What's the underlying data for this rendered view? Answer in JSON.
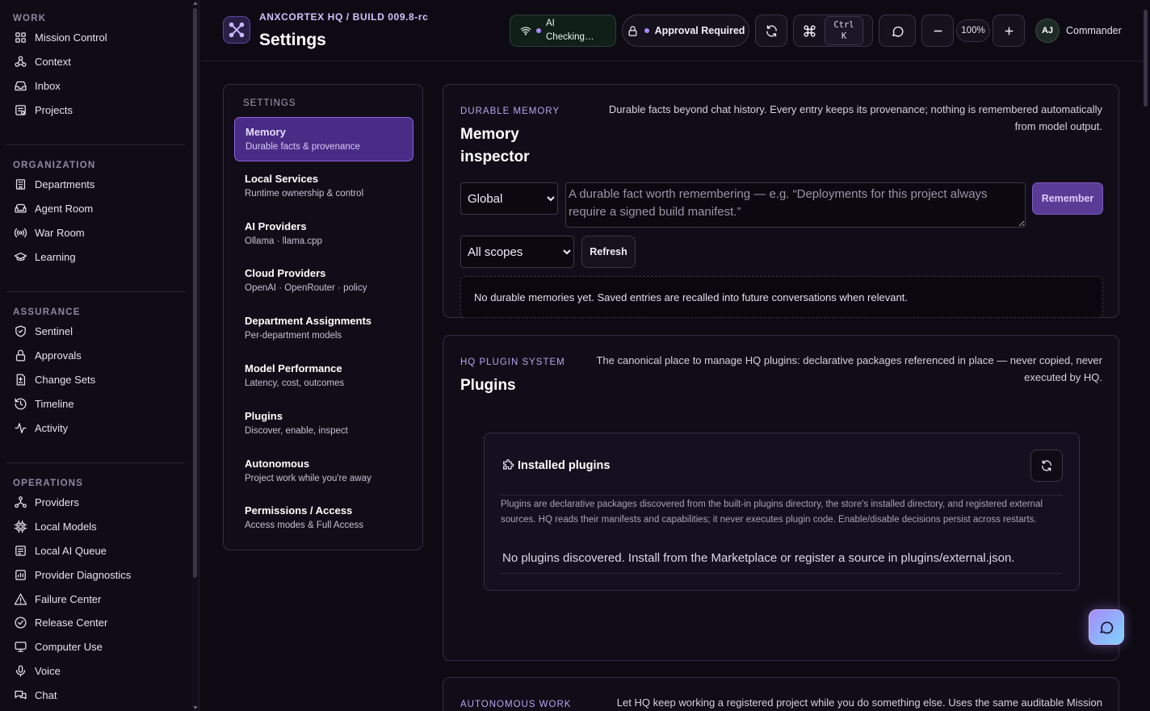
{
  "nav": {
    "sections": [
      {
        "heading": "WORK",
        "items": [
          {
            "label": "Mission Control",
            "icon": "grid-icon"
          },
          {
            "label": "Context",
            "icon": "network-icon"
          },
          {
            "label": "Inbox",
            "icon": "inbox-icon"
          },
          {
            "label": "Projects",
            "icon": "project-icon"
          }
        ]
      },
      {
        "heading": "ORGANIZATION",
        "items": [
          {
            "label": "Departments",
            "icon": "building-icon"
          },
          {
            "label": "Agent Room",
            "icon": "sofa-icon"
          },
          {
            "label": "War Room",
            "icon": "radio-icon"
          },
          {
            "label": "Learning",
            "icon": "graduation-cap-icon"
          }
        ]
      },
      {
        "heading": "ASSURANCE",
        "items": [
          {
            "label": "Sentinel",
            "icon": "shield-check-icon"
          },
          {
            "label": "Approvals",
            "icon": "lock-icon"
          },
          {
            "label": "Change Sets",
            "icon": "file-diff-icon"
          },
          {
            "label": "Timeline",
            "icon": "history-icon"
          },
          {
            "label": "Activity",
            "icon": "activity-icon"
          }
        ]
      },
      {
        "heading": "OPERATIONS",
        "items": [
          {
            "label": "Providers",
            "icon": "nodes-icon"
          },
          {
            "label": "Local Models",
            "icon": "cpu-icon"
          },
          {
            "label": "Local AI Queue",
            "icon": "queue-icon"
          },
          {
            "label": "Provider Diagnostics",
            "icon": "diagnostics-icon"
          },
          {
            "label": "Failure Center",
            "icon": "warning-triangle-icon"
          },
          {
            "label": "Release Center",
            "icon": "check-circle-icon"
          },
          {
            "label": "Computer Use",
            "icon": "monitor-icon"
          },
          {
            "label": "Voice",
            "icon": "microphone-icon"
          },
          {
            "label": "Chat",
            "icon": "chat-bubbles-icon"
          }
        ]
      }
    ]
  },
  "header": {
    "breadcrumb": "ANXCORTEX HQ / BUILD 009.8-rc",
    "title": "Settings",
    "ai_status_line1": "AI",
    "ai_status_line2": "Checking…",
    "approval": "Approval Required",
    "kbd_line1": "Ctrl",
    "kbd_line2": "K",
    "zoom": "100%",
    "avatar_initials": "AJ",
    "user_name": "Commander"
  },
  "settings_nav": {
    "heading": "SETTINGS",
    "items": [
      {
        "title": "Memory",
        "desc": "Durable facts & provenance",
        "active": true
      },
      {
        "title": "Local Services",
        "desc": "Runtime ownership & control"
      },
      {
        "title": "AI Providers",
        "desc": "Ollama · llama.cpp"
      },
      {
        "title": "Cloud Providers",
        "desc": "OpenAI · OpenRouter · policy"
      },
      {
        "title": "Department Assignments",
        "desc": "Per-department models"
      },
      {
        "title": "Model Performance",
        "desc": "Latency, cost, outcomes"
      },
      {
        "title": "Plugins",
        "desc": "Discover, enable, inspect"
      },
      {
        "title": "Autonomous",
        "desc": "Project work while you're away"
      },
      {
        "title": "Permissions / Access",
        "desc": "Access modes & Full Access"
      }
    ]
  },
  "memory": {
    "eyebrow": "DURABLE MEMORY",
    "title_line1": "Memory",
    "title_line2": "inspector",
    "desc_line1": "Durable facts beyond chat history. Every entry keeps its provenance; nothing is remembered automatically",
    "desc_line2": "from model output.",
    "scope_value": "Global",
    "fact_placeholder": "A durable fact worth remembering — e.g. “Deployments for this project always require a signed build manifest.”",
    "remember_label": "Remember",
    "filter_value": "All scopes",
    "refresh_label": "Refresh",
    "empty": "No durable memories yet. Saved entries are recalled into future conversations when relevant."
  },
  "plugins": {
    "eyebrow": "HQ PLUGIN SYSTEM",
    "title": "Plugins",
    "desc_line1": "The canonical place to manage HQ plugins: declarative packages referenced in place — never copied, never",
    "desc_line2": "executed by HQ.",
    "installed_title": "Installed plugins",
    "installed_desc": "Plugins are declarative packages discovered from the built-in plugins directory, the store's installed directory, and registered external sources. HQ reads their manifests and capabilities; it never executes plugin code. Enable/disable decisions persist across restarts.",
    "empty": "No plugins discovered. Install from the Marketplace or register a source in plugins/external.json."
  },
  "autonomous": {
    "eyebrow": "AUTONOMOUS WORK",
    "desc_line1": "Let HQ keep working a registered project while you do something else. Uses the same auditable Mission"
  },
  "colors": {
    "accent": "#8a65e0",
    "background": "#0d0a13",
    "panel": "#110d18"
  }
}
